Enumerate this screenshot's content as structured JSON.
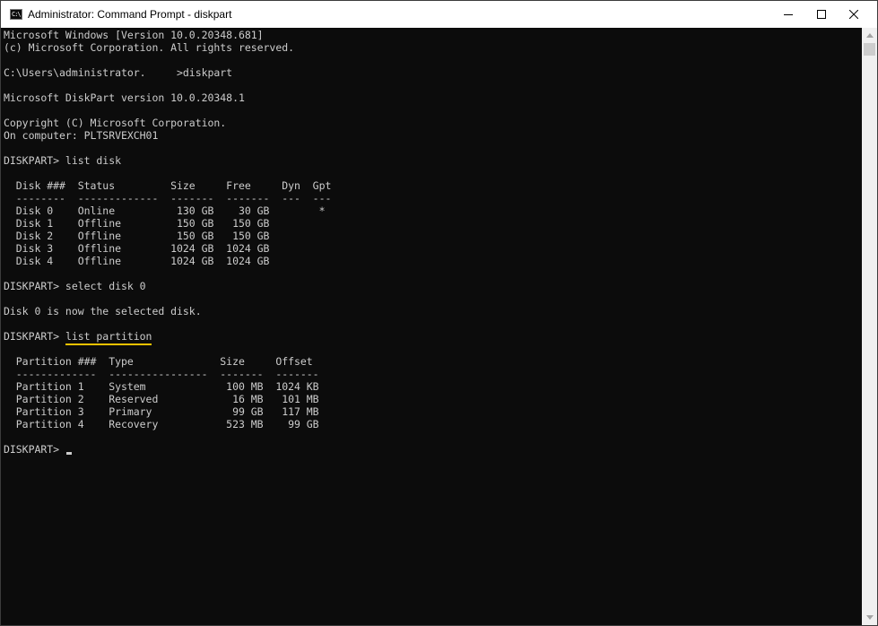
{
  "window": {
    "title": "Administrator: Command Prompt - diskpart",
    "icon": "cmd-icon",
    "icon_glyph": "C:\\",
    "controls": [
      "minimize-icon",
      "maximize-icon",
      "close-icon"
    ]
  },
  "console": {
    "lines": [
      "Microsoft Windows [Version 10.0.20348.681]",
      "(c) Microsoft Corporation. All rights reserved.",
      "",
      "C:\\Users\\administrator.     >diskpart",
      "",
      "Microsoft DiskPart version 10.0.20348.1",
      "",
      "Copyright (C) Microsoft Corporation.",
      "On computer: PLTSRVEXCH01",
      "",
      "DISKPART> list disk",
      "",
      "  Disk ###  Status         Size     Free     Dyn  Gpt",
      "  --------  -------------  -------  -------  ---  ---",
      "  Disk 0    Online          130 GB    30 GB        *",
      "  Disk 1    Offline         150 GB   150 GB",
      "  Disk 2    Offline         150 GB   150 GB",
      "  Disk 3    Offline        1024 GB  1024 GB",
      "  Disk 4    Offline        1024 GB  1024 GB",
      "",
      "DISKPART> select disk 0",
      "",
      "Disk 0 is now the selected disk.",
      "",
      "",
      "",
      "  Partition ###  Type              Size     Offset",
      "  -------------  ----------------  -------  -------",
      "  Partition 1    System             100 MB  1024 KB",
      "  Partition 2    Reserved            16 MB   101 MB",
      "  Partition 3    Primary             99 GB   117 MB",
      "  Partition 4    Recovery           523 MB    99 GB",
      "",
      ""
    ],
    "highlighted_prompt": "DISKPART> ",
    "highlighted_command": "list partition",
    "final_prompt": "DISKPART> ",
    "highlight_color": "#f2c200",
    "text_color": "#cccccc",
    "background_color": "#0c0c0c"
  },
  "scrollbar": {
    "up_icon": "scroll-up-arrow-icon",
    "down_icon": "scroll-down-arrow-icon"
  }
}
